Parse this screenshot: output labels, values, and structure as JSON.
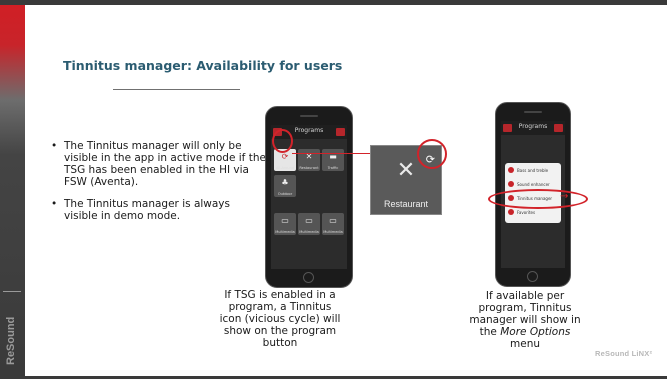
{
  "slide": {
    "title": "Tinnitus manager: Availability for users",
    "brand": "ReSound",
    "logo": "ReSound LiNX²",
    "colors": {
      "title": "#2b5c71",
      "accent_red": "#d2232a",
      "sidebar_red": "#c8242a"
    }
  },
  "bullets": [
    "The Tinnitus manager will only be visible in the app in active mode if the TSG has been enabled in the HI via FSW (Aventa).",
    "The Tinnitus manager is always visible in demo mode."
  ],
  "bullet_glyph": "•",
  "captions": {
    "left": "If TSG is enabled in a program, a Tinnitus icon (vicious cycle) will show on the program button",
    "right_part1": "If available per program, Tinnitus manager will show in the ",
    "right_italic": "More Options",
    "right_part2": " menu"
  },
  "phone1": {
    "header": "Programs",
    "tiles": [
      {
        "label": "All-Around",
        "icon": "tinnitus-icon"
      },
      {
        "label": "Restaurant",
        "icon": "fork-knife-icon"
      },
      {
        "label": "Traffic",
        "icon": "car-icon"
      },
      {
        "label": "Outdoor",
        "icon": "tree-icon"
      },
      {
        "label": "Multimedia",
        "icon": "speaker-icon"
      },
      {
        "label": "Multimedia",
        "icon": "speaker-icon"
      },
      {
        "label": "Multimedia",
        "icon": "speaker-icon"
      }
    ]
  },
  "zoom": {
    "label": "Restaurant",
    "icon": "fork-knife-icon",
    "badge_icon": "tinnitus-icon"
  },
  "phone2": {
    "header": "Programs",
    "menu_items": [
      "Bass and treble",
      "Sound enhancer",
      "Tinnitus manager",
      "Favorites"
    ]
  }
}
